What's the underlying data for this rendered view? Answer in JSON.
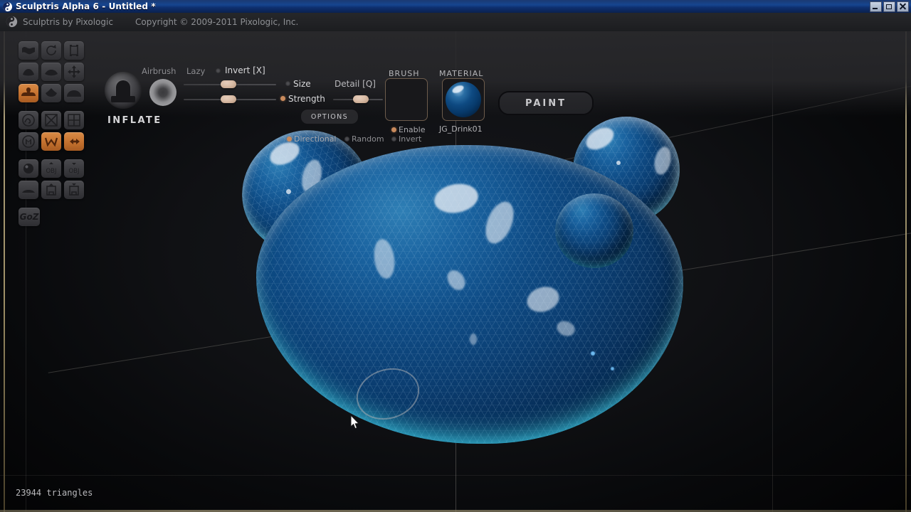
{
  "window": {
    "title": "Sculptris Alpha 6 - Untitled *",
    "logo_icon": "sculptris-logo-icon",
    "controls": {
      "minimize": "minimize-icon",
      "maximize": "maximize-icon",
      "close": "close-icon"
    }
  },
  "menustrip": {
    "logo_icon": "pixologic-logo-icon",
    "brand": "Sculptris by Pixologic",
    "copyright": "Copyright © 2009-2011 Pixologic, Inc."
  },
  "toolbar": {
    "tool_preview_icon": "inflate-preview-icon",
    "tool_name": "INFLATE",
    "brush_falloff_icon": "brush-falloff-icon",
    "airbrush_label": "Airbrush",
    "lazy_label": "Lazy",
    "invert_x_label": "Invert [X]",
    "size_label": "Size",
    "strength_label": "Strength",
    "detail_q_label": "Detail [Q]",
    "options_label": "OPTIONS",
    "directional_label": "Directional",
    "random_label": "Random",
    "invert_label": "Invert",
    "enable_label": "Enable",
    "brush_label": "BRUSH",
    "material_label": "MATERIAL",
    "material_name": "JG_Drink01",
    "paint_label": "PAINT",
    "sliders": {
      "size_value": 40,
      "strength_value": 40,
      "detail_value": 40
    },
    "toggles": {
      "invert_x": false,
      "size": false,
      "strength": true,
      "directional": true,
      "random": false,
      "invert": false,
      "enable": true
    }
  },
  "tools": {
    "rows": [
      [
        {
          "name": "tool-crease",
          "active": false
        },
        {
          "name": "tool-rotate",
          "active": false
        },
        {
          "name": "tool-crop",
          "active": false
        }
      ],
      [
        {
          "name": "tool-scale",
          "active": false
        },
        {
          "name": "tool-smooth",
          "active": false
        },
        {
          "name": "tool-move",
          "active": false
        }
      ],
      [
        {
          "name": "tool-inflate",
          "active": true
        },
        {
          "name": "tool-pinch",
          "active": false
        },
        {
          "name": "tool-flatten",
          "active": false
        }
      ],
      [
        {
          "name": "tool-spin",
          "active": false
        },
        {
          "name": "tool-mask",
          "active": false
        },
        {
          "name": "tool-grid",
          "active": false
        }
      ],
      [
        {
          "name": "tool-material-m",
          "active": false
        },
        {
          "name": "tool-wireframe",
          "active": true
        },
        {
          "name": "tool-symmetry",
          "active": true
        }
      ],
      [
        {
          "name": "tool-new-sphere",
          "active": false
        },
        {
          "name": "tool-import-obj",
          "active": false
        },
        {
          "name": "tool-export-obj",
          "active": false
        }
      ],
      [
        {
          "name": "tool-new-plane",
          "active": false
        },
        {
          "name": "tool-open-file",
          "active": false
        },
        {
          "name": "tool-save-file",
          "active": false
        }
      ]
    ],
    "goz_label": "GoZ"
  },
  "viewport": {
    "model_name": "blue-glossy-blob-model",
    "brush_cursor_icon": "brush-cursor-ring",
    "mouse_cursor_icon": "mouse-pointer-icon"
  },
  "status": {
    "triangles": "23944 triangles"
  },
  "colors": {
    "accent_orange": "#c4712f",
    "title_blue": "#16458f",
    "model_blue": "#0f4c86",
    "rim_cyan": "#40dcff",
    "border_tan": "#b9a877"
  }
}
